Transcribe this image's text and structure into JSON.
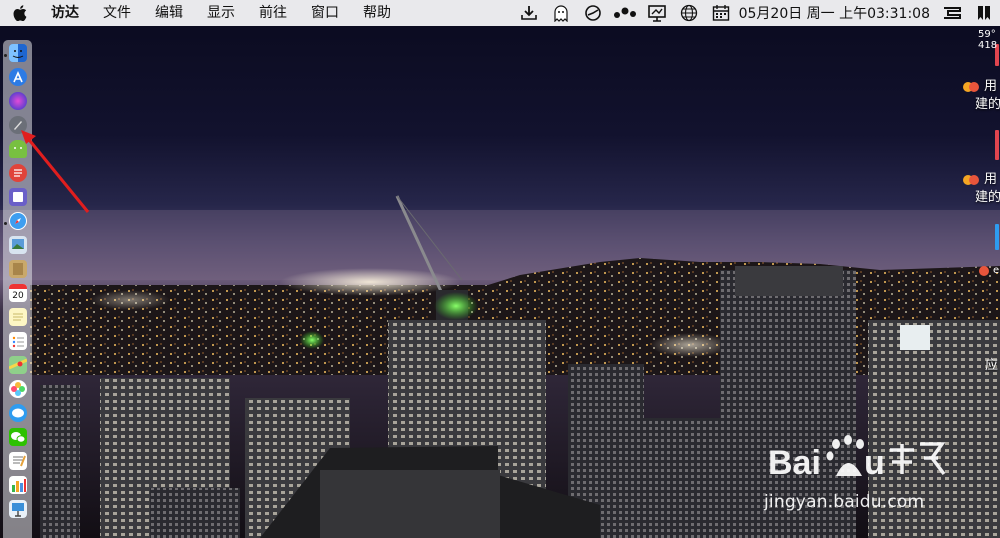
{
  "menubar": {
    "app_name": "访达",
    "menus": [
      "文件",
      "编辑",
      "显示",
      "前往",
      "窗口",
      "帮助"
    ],
    "clock": "05月20日 周一 上午03:31:08"
  },
  "notifications": [
    {
      "line1": "用",
      "line2": "建的"
    },
    {
      "line1": "用",
      "line2": "建的"
    }
  ],
  "side_fragments": {
    "temp": "59°",
    "num": "418",
    "short1": "e",
    "short2": "应"
  },
  "dock": {
    "calendar_day": "20",
    "items": [
      "finder",
      "app-store",
      "siri",
      "launchpad",
      "android-studio",
      "task-app",
      "screenshot-app",
      "safari",
      "preview",
      "notes-app",
      "calendar",
      "stickies",
      "reminders",
      "maps",
      "photos",
      "messages",
      "wechat",
      "textedit",
      "numbers",
      "keynote"
    ]
  },
  "watermark": {
    "url": "jingyan.baidu.com"
  }
}
